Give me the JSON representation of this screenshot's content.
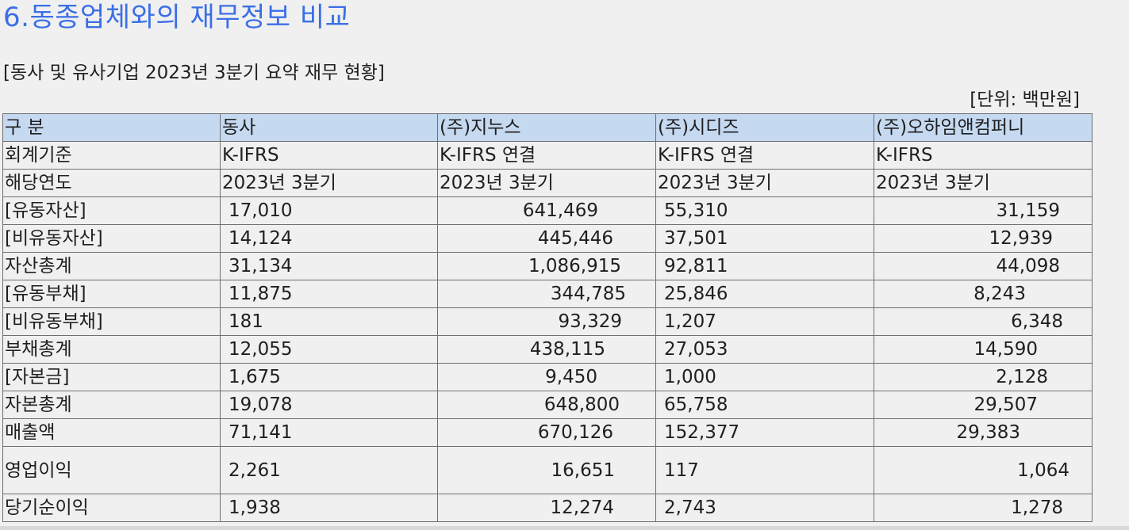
{
  "title": "6.동종업체와의 재무정보 비교",
  "subtitle": "[동사 및 유사기업 2023년 3분기 요약 재무 현황]",
  "unit": "[단위: 백만원]",
  "table": {
    "header": [
      "구 분",
      "동사",
      "(주)지누스",
      "(주)시디즈",
      "(주)오하임앤컴퍼니"
    ],
    "standard": [
      "회계기준",
      "K-IFRS",
      "K-IFRS 연결",
      "K-IFRS 연결",
      "K-IFRS"
    ],
    "period": [
      "해당연도",
      "2023년 3분기",
      "2023년 3분기",
      "2023년 3분기",
      "2023년 3분기"
    ],
    "rows": [
      [
        "[유동자산]",
        "17,010",
        "641,469",
        "55,310",
        "31,159"
      ],
      [
        "[비유동자산]",
        "14,124",
        "445,446",
        "37,501",
        "12,939"
      ],
      [
        "자산총계",
        "31,134",
        "1,086,915",
        "92,811",
        "44,098"
      ],
      [
        "[유동부채]",
        "11,875",
        "344,785",
        "25,846",
        "8,243"
      ],
      [
        "[비유동부채]",
        "181",
        "93,329",
        "1,207",
        "6,348"
      ],
      [
        "부채총계",
        "12,055",
        "438,115",
        "27,053",
        "14,590"
      ],
      [
        "[자본금]",
        "1,675",
        "9,450",
        "1,000",
        "2,128"
      ],
      [
        "자본총계",
        "19,078",
        "648,800",
        "65,758",
        "29,507"
      ],
      [
        "매출액",
        "71,141",
        "670,126",
        "152,377",
        "29,383"
      ],
      [
        "영업이익",
        "2,261",
        "16,651",
        "117",
        "1,064"
      ],
      [
        "당기순이익",
        "1,938",
        "12,274",
        "2,743",
        "1,278"
      ]
    ]
  }
}
